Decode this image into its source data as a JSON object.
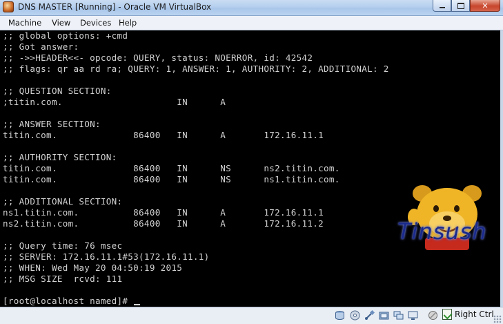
{
  "window": {
    "title": "DNS MASTER [Running] - Oracle VM VirtualBox",
    "controls": [
      "minimize",
      "maximize",
      "close"
    ]
  },
  "menubar": {
    "items": [
      "Machine",
      "View",
      "Devices",
      "Help"
    ]
  },
  "console": {
    "lines": [
      ";; global options: +cmd",
      ";; Got answer:",
      ";; ->>HEADER<<- opcode: QUERY, status: NOERROR, id: 42542",
      ";; flags: qr aa rd ra; QUERY: 1, ANSWER: 1, AUTHORITY: 2, ADDITIONAL: 2",
      "",
      ";; QUESTION SECTION:",
      ";titin.com.                     IN      A",
      "",
      ";; ANSWER SECTION:",
      "titin.com.              86400   IN      A       172.16.11.1",
      "",
      ";; AUTHORITY SECTION:",
      "titin.com.              86400   IN      NS      ns2.titin.com.",
      "titin.com.              86400   IN      NS      ns1.titin.com.",
      "",
      ";; ADDITIONAL SECTION:",
      "ns1.titin.com.          86400   IN      A       172.16.11.1",
      "ns2.titin.com.          86400   IN      A       172.16.11.2",
      "",
      ";; Query time: 76 msec",
      ";; SERVER: 172.16.11.1#53(172.16.11.1)",
      ";; WHEN: Wed May 20 04:50:19 2015",
      ";; MSG SIZE  rcvd: 111",
      "",
      "[root@localhost named]# "
    ],
    "watermark": "Tinsush"
  },
  "statusbar": {
    "icons": [
      "hard-disk-icon",
      "optical-drive-icon",
      "usb-icon",
      "shared-folders-icon",
      "network-icon",
      "display-icon",
      "video-capture-icon",
      "mouse-integration-icon"
    ],
    "host_key": "Right Ctrl"
  }
}
